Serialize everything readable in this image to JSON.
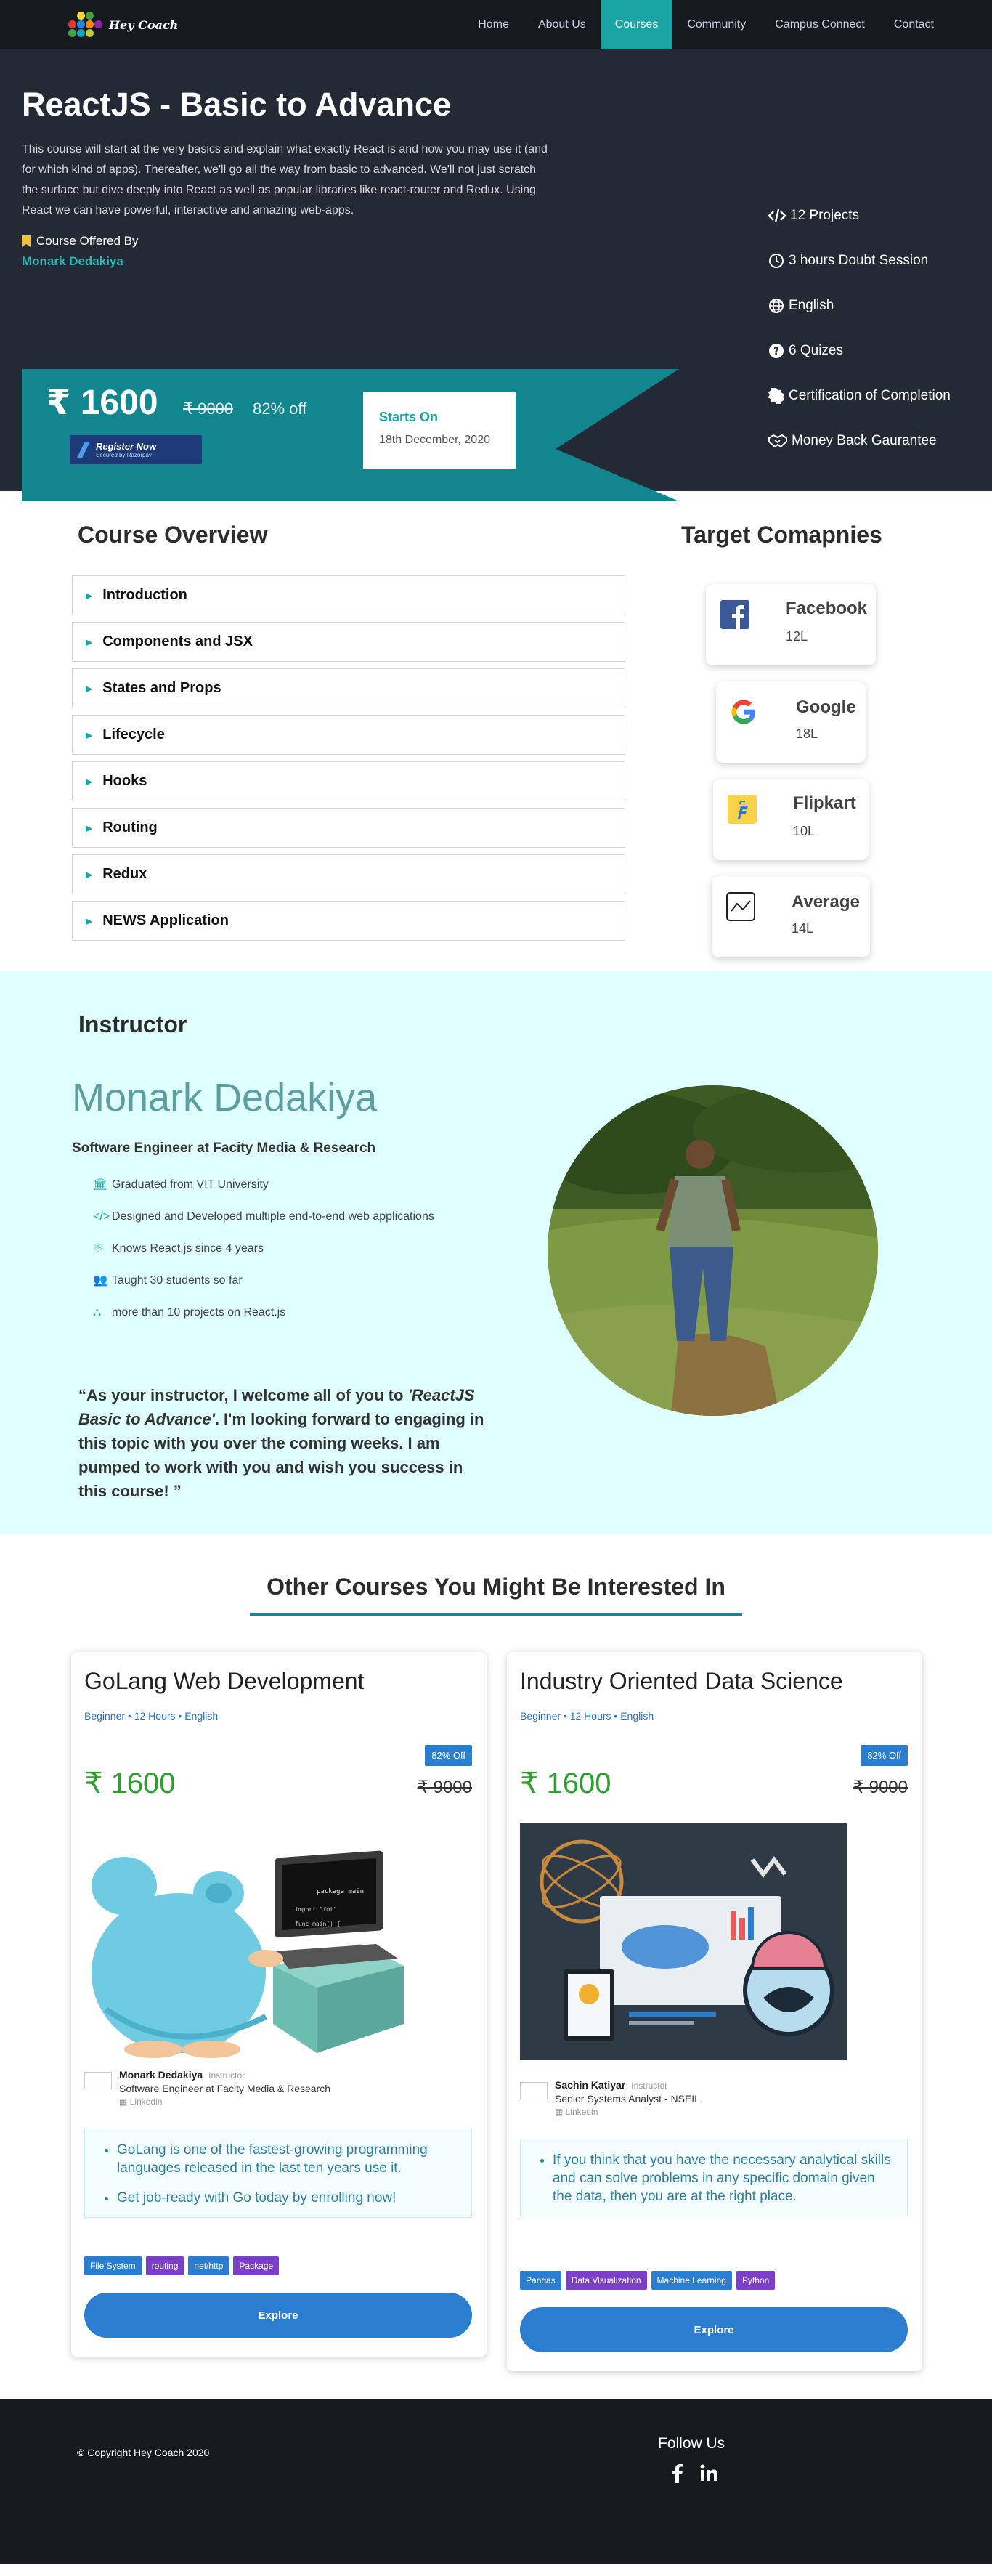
{
  "nav": {
    "logo_text": "Hey Coach",
    "items": [
      "Home",
      "About Us",
      "Courses",
      "Community",
      "Campus Connect",
      "Contact"
    ],
    "active": "Courses"
  },
  "hero": {
    "title": "ReactJS - Basic to Advance",
    "description": "This course will start at the very basics and explain what exactly React is and how you may use it (and for which kind of apps). Thereafter, we'll go all the way from basic to advanced. We'll not just scratch the surface but dive deeply into React as well as popular libraries like react-router and Redux. Using React we can have powerful, interactive and amazing web-apps.",
    "offered_by_label": "Course Offered By",
    "offered_by": "Monark Dedakiya",
    "price": "₹ 1600",
    "old_price": "₹ 9000",
    "discount": "82% off",
    "register": {
      "label": "Register Now",
      "secured": "Secured by Razorpay"
    },
    "starts_label": "Starts On",
    "starts_date": "18th December, 2020",
    "features": [
      {
        "icon": "code-icon",
        "text": "12 Projects"
      },
      {
        "icon": "clock-icon",
        "text": "3 hours Doubt Session"
      },
      {
        "icon": "globe-icon",
        "text": "English"
      },
      {
        "icon": "question-icon",
        "text": "6 Quizes"
      },
      {
        "icon": "certificate-icon",
        "text": "Certification of Completion"
      },
      {
        "icon": "handshake-icon",
        "text": "Money Back Gaurantee"
      }
    ]
  },
  "overview": {
    "title": "Course Overview",
    "items": [
      "Introduction",
      "Components and JSX",
      "States and Props",
      "Lifecycle",
      "Hooks",
      "Routing",
      "Redux",
      "NEWS Application"
    ]
  },
  "target": {
    "title": "Target Comapnies",
    "companies": [
      {
        "name": "Facebook",
        "count": "12L",
        "icon": "facebook-icon",
        "color": "#3b5998"
      },
      {
        "name": "Google",
        "count": "18L",
        "icon": "google-icon",
        "color": "#4285f4"
      },
      {
        "name": "Flipkart",
        "count": "10L",
        "icon": "flipkart-icon",
        "color": "#f7d24a"
      },
      {
        "name": "Average",
        "count": "14L",
        "icon": "chart-icon",
        "color": "#222222"
      }
    ]
  },
  "instructor": {
    "heading": "Instructor",
    "name": "Monark Dedakiya",
    "role": "Software Engineer at Facity Media & Research",
    "points": [
      {
        "icon": "university-icon",
        "text": "Graduated from VIT University"
      },
      {
        "icon": "code-icon",
        "text": "Designed and Developed multiple end-to-end web applications"
      },
      {
        "icon": "react-icon",
        "text": "Knows React.js since 4 years"
      },
      {
        "icon": "users-icon",
        "text": "Taught 30 students so far"
      },
      {
        "icon": "sitemap-icon",
        "text": "more than 10 projects on React.js"
      }
    ],
    "quote_open": "“As your instructor, I welcome all of you to ",
    "quote_course": "'ReactJS Basic to Advance'",
    "quote_rest": ". I'm looking forward to engaging in this topic with you over the coming weeks. I am pumped to work with you and wish you success in this course! ”"
  },
  "other": {
    "title": "Other Courses You Might Be Interested In",
    "cards": [
      {
        "title": "GoLang Web Development",
        "meta": "Beginner • 12 Hours • English",
        "off": "82% Off",
        "price": "₹ 1600",
        "old_price": "₹ 9000",
        "author": "Monark Dedakiya",
        "author_tag": "Instructor",
        "author_role": "Software Engineer at Facity Media & Research",
        "author_link": "Linkedin",
        "points": [
          "GoLang is one of the fastest-growing programming languages released in the last ten years use it.",
          "Get job-ready with Go today by enrolling now!"
        ],
        "tags": [
          {
            "label": "File System",
            "color": "#2b7dd0"
          },
          {
            "label": "routing",
            "color": "#7b3fc8"
          },
          {
            "label": "net/http",
            "color": "#2b7dd0"
          },
          {
            "label": "Package",
            "color": "#7b3fc8"
          }
        ],
        "explore": "Explore"
      },
      {
        "title": "Industry Oriented Data Science",
        "meta": "Beginner • 12 Hours • English",
        "off": "82% Off",
        "price": "₹ 1600",
        "old_price": "₹ 9000",
        "author": "Sachin Katiyar",
        "author_tag": "Instructor",
        "author_role": "Senior Systems Analyst - NSEIL",
        "author_link": "Linkedin",
        "points": [
          "If you think that you have the necessary analytical skills and can solve problems in any specific domain given the data, then you are at the right place."
        ],
        "tags": [
          {
            "label": "Pandas",
            "color": "#2b7dd0"
          },
          {
            "label": "Data Visualization",
            "color": "#7b3fc8"
          },
          {
            "label": "Machine Learning",
            "color": "#2b7dd0"
          },
          {
            "label": "Python",
            "color": "#7b3fc8"
          }
        ],
        "explore": "Explore"
      }
    ]
  },
  "footer": {
    "copyright": "© Copyright Hey Coach 2020",
    "follow": "Follow Us",
    "social": [
      "facebook-icon",
      "linkedin-icon"
    ]
  },
  "colors": {
    "teal": "#1aa4a4",
    "dark": "#242a35",
    "nav": "#16191e",
    "blue": "#2b7dd0",
    "purple": "#7b3fc8"
  }
}
